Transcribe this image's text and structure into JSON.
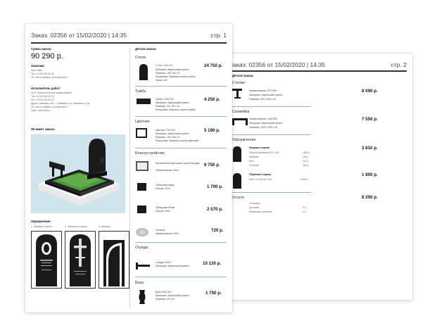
{
  "page1": {
    "title": "Заказ: 02356 от 15/02/2020 | 14:35",
    "page_label": "стр. 1",
    "sum_label": "Сумма заказа:",
    "sum_value": "90 290 р.",
    "customer_label": "Заказчик:",
    "customer_lines": [
      "Имя: Иван",
      "Тел.: 8-000-000-00-00",
      "Эл. почта: пример_почты@mail.ru"
    ],
    "contractor_label": "Исполнитель работ:",
    "contractor_lines": [
      "ООО \"Фантастическое наименование\"",
      "Тел.: 8-000-000-00-00",
      "Тел.: 8-000-000-00-00",
      "Адрес: Название обл., г. Название, ул. Название, д. №",
      "Эл. почта: пример_почты@mail.ru",
      "Сайт: www.сайт.ru"
    ],
    "model_label": "3D-макет заказа:",
    "design_label": "Оформление:",
    "design_captions": [
      "1. Лицевая сторона",
      "2. Обратная сторона",
      "3. Цветник"
    ],
    "details_label": "Детали заказа:",
    "sections": [
      {
        "name": "Стела",
        "items": [
          {
            "lines": [
              "Стела: ХАВ-001",
              "Материал: Карельский гранит...",
              "Размеры: 180 х 80 х 8",
              "Полировка: Лицевая сторона стелы",
              "Фаска: нет"
            ],
            "price": "24 750 р."
          }
        ]
      },
      {
        "name": "Тумба",
        "items": [
          {
            "lines": [
              "Тумба: TUM-002",
              "Материал: Карельский гранит...",
              "Размеры: 20 х 90 х 20",
              "Полировка: Лицевая сторона тумбы"
            ],
            "price": "4 250 р."
          }
        ]
      },
      {
        "name": "Цветник",
        "items": [
          {
            "lines": [
              "Цветник: TSV-002",
              "Материал: Карельский гранит...",
              "Размеры: 100 х 80 х 8",
              "Полировка: Лицевая сторона цветника"
            ],
            "price": "5 190 р."
          }
        ]
      },
      {
        "name": "Благоустройство",
        "items": [
          {
            "lines": [
              "Железобетонный цоколь под облицовку",
              "Наименование: 0003"
            ],
            "price": "9 750 р."
          },
          {
            "lines": [
              "Облицовка меры",
              "Плитка: 0003"
            ],
            "price": "1 700 р."
          },
          {
            "lines": [
              "Облицовка боков",
              "Плитка: 0002"
            ],
            "price": "2 570 р."
          },
          {
            "lines": [
              "Отсыпка",
              "Наименование: 0003"
            ],
            "price": "720 р."
          }
        ]
      },
      {
        "name": "Ограда",
        "items": [
          {
            "lines": [
              "Ограда: 00ХХ",
              "Материал: Карельский гранит..."
            ],
            "price": "10 130 р."
          }
        ]
      },
      {
        "name": "Ваза",
        "items": [
          {
            "lines": [
              "Ваза: ВАЗ-001",
              "Материал: Карельский гранит...",
              "Размеры: 25 х 40"
            ],
            "price": "1 750 р."
          }
        ]
      }
    ]
  },
  "page2": {
    "title": "Заказ: 02356 от 15/02/2020 | 14:35",
    "page_label": "стр. 2",
    "details_label": "Детали заказа:",
    "sections": [
      {
        "name": "Столик",
        "items": [
          {
            "lines": [
              "Наименование: STS-999",
              "Материал: Карельский гранит...",
              "Размеры: 500 х 500 х 40"
            ],
            "price": "8 090 р."
          }
        ]
      },
      {
        "name": "Скамейка",
        "items": [
          {
            "lines": [
              "Наименование: CAM-999",
              "Материал: Карельский гранит...",
              "Размеры: 1000 х 250 х 40"
            ],
            "price": "7 550 р."
          }
        ]
      },
      {
        "name": "Оформление",
        "items": [
          {
            "lines": [
              "Лицевая сторона",
              "Портрет/овальный (40 х 30)",
              "Фамилия",
              "Имя",
              "Отчество"
            ],
            "values": [
              "",
              "1800 р.",
              "155 р.",
              "110 р.",
              "360 р."
            ],
            "price": "3 810 р."
          },
          {
            "lines": [
              "Обратная сторона",
              "Крест № (65 см х 25)"
            ],
            "values": [
              "",
              "1 800 р."
            ],
            "price": "1 800 р."
          }
        ]
      },
      {
        "name": "Услуги",
        "items": [
          {
            "lines": [
              "Установка",
              "Доставка",
              "Временное хранение"
            ],
            "values": [
              "",
              "0 р.",
              "0 р."
            ],
            "price": "8 200 р."
          }
        ]
      }
    ]
  },
  "colors": {
    "paper": "#ffffff",
    "accent_rule": "#8fb4cf",
    "model_bg": "#cfe3ec",
    "granite": "#1a1a1a",
    "grass": "#4d9a3c"
  }
}
